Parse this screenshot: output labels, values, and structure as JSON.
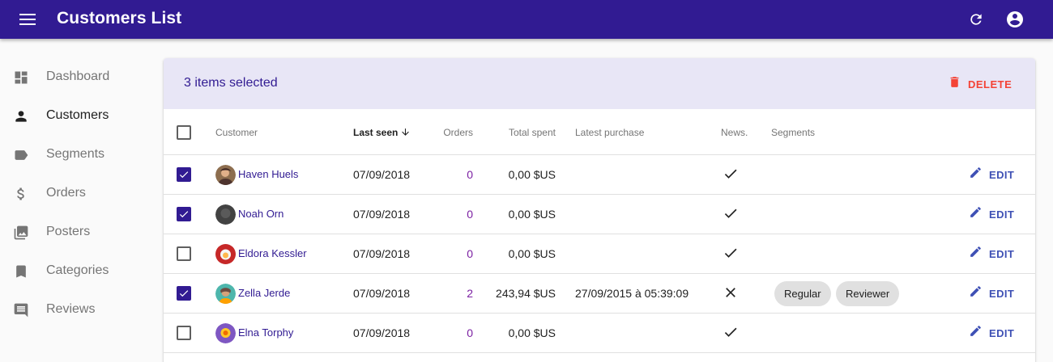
{
  "appbar": {
    "title": "Customers List",
    "icons": {
      "menu": "menu-icon",
      "refresh": "refresh-icon",
      "account": "account-circle-icon"
    }
  },
  "sidebar": {
    "items": [
      {
        "label": "Dashboard",
        "icon": "dashboard-icon",
        "active": false
      },
      {
        "label": "Customers",
        "icon": "person-icon",
        "active": true
      },
      {
        "label": "Segments",
        "icon": "label-icon",
        "active": false
      },
      {
        "label": "Orders",
        "icon": "dollar-icon",
        "active": false
      },
      {
        "label": "Posters",
        "icon": "collections-icon",
        "active": false
      },
      {
        "label": "Categories",
        "icon": "bookmark-icon",
        "active": false
      },
      {
        "label": "Reviews",
        "icon": "comment-icon",
        "active": false
      }
    ]
  },
  "bulk": {
    "selected_text": "3 items selected",
    "delete_label": "DELETE"
  },
  "table": {
    "headers": {
      "customer": "Customer",
      "last_seen": "Last seen",
      "orders": "Orders",
      "total_spent": "Total spent",
      "latest_purchase": "Latest purchase",
      "news": "News.",
      "segments": "Segments"
    },
    "sort": {
      "column": "last_seen",
      "direction": "desc"
    },
    "edit_label": "EDIT",
    "rows": [
      {
        "checked": true,
        "name": "Haven Huels",
        "last_seen": "07/09/2018",
        "orders": "0",
        "spent": "0,00 $US",
        "latest": "",
        "news": "check",
        "segments": []
      },
      {
        "checked": true,
        "name": "Noah Orn",
        "last_seen": "07/09/2018",
        "orders": "0",
        "spent": "0,00 $US",
        "latest": "",
        "news": "check",
        "segments": []
      },
      {
        "checked": false,
        "name": "Eldora Kessler",
        "last_seen": "07/09/2018",
        "orders": "0",
        "spent": "0,00 $US",
        "latest": "",
        "news": "check",
        "segments": []
      },
      {
        "checked": true,
        "name": "Zella Jerde",
        "last_seen": "07/09/2018",
        "orders": "2",
        "spent": "243,94 $US",
        "latest": "27/09/2015 à 05:39:09",
        "news": "close",
        "segments": [
          "Regular",
          "Reviewer"
        ]
      },
      {
        "checked": false,
        "name": "Elna Torphy",
        "last_seen": "07/09/2018",
        "orders": "0",
        "spent": "0,00 $US",
        "latest": "",
        "news": "check",
        "segments": []
      }
    ]
  },
  "colors": {
    "primary": "#311b92",
    "delete": "#f44336",
    "edit": "#3f51b5",
    "orders": "#7b1fa2",
    "bulk_bg": "#e8e6f6",
    "chip_bg": "#e0e0e0"
  }
}
